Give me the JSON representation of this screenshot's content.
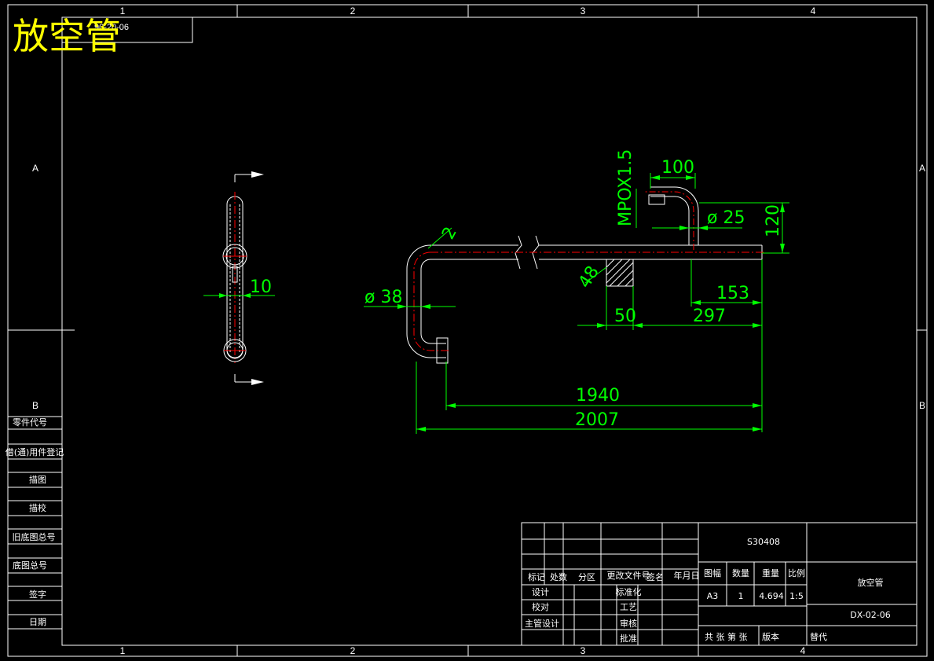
{
  "title": {
    "big": "放空管",
    "code_box": "90-20-06"
  },
  "zones": {
    "cols": [
      "1",
      "2",
      "3",
      "4"
    ],
    "rows": [
      "A",
      "B"
    ]
  },
  "side_panel": [
    "零件代号",
    "借(通)用件登记",
    "描图",
    "描校",
    "旧底图总号",
    "底图总号",
    "签字",
    "日期"
  ],
  "dimensions": {
    "d100": "100",
    "mpo": "MPOX1.5",
    "dia25": "ø 25",
    "d120": "120",
    "d2": "2",
    "d48": "48",
    "dia38": "ø 38",
    "d153": "153",
    "d50": "50",
    "d297": "297",
    "d1940": "1940",
    "d2007": "2007",
    "d10": "10"
  },
  "title_block": {
    "material": "S30408",
    "headers": [
      "标记",
      "处数",
      "分区",
      "更改文件号",
      "签名",
      "年月日"
    ],
    "left_labels": [
      "设计",
      "校对",
      "主管设计"
    ],
    "mid_labels": [
      "标准化",
      "工艺",
      "审核",
      "批准"
    ],
    "info_headers": [
      "图幅",
      "数量",
      "重量",
      "比例"
    ],
    "info_values": [
      "A3",
      "1",
      "4.694",
      "1:5"
    ],
    "name": "放空管",
    "drawing_no": "DX-02-06",
    "bottom_labels": [
      "共 张 第 张",
      "版本",
      "替代"
    ]
  }
}
